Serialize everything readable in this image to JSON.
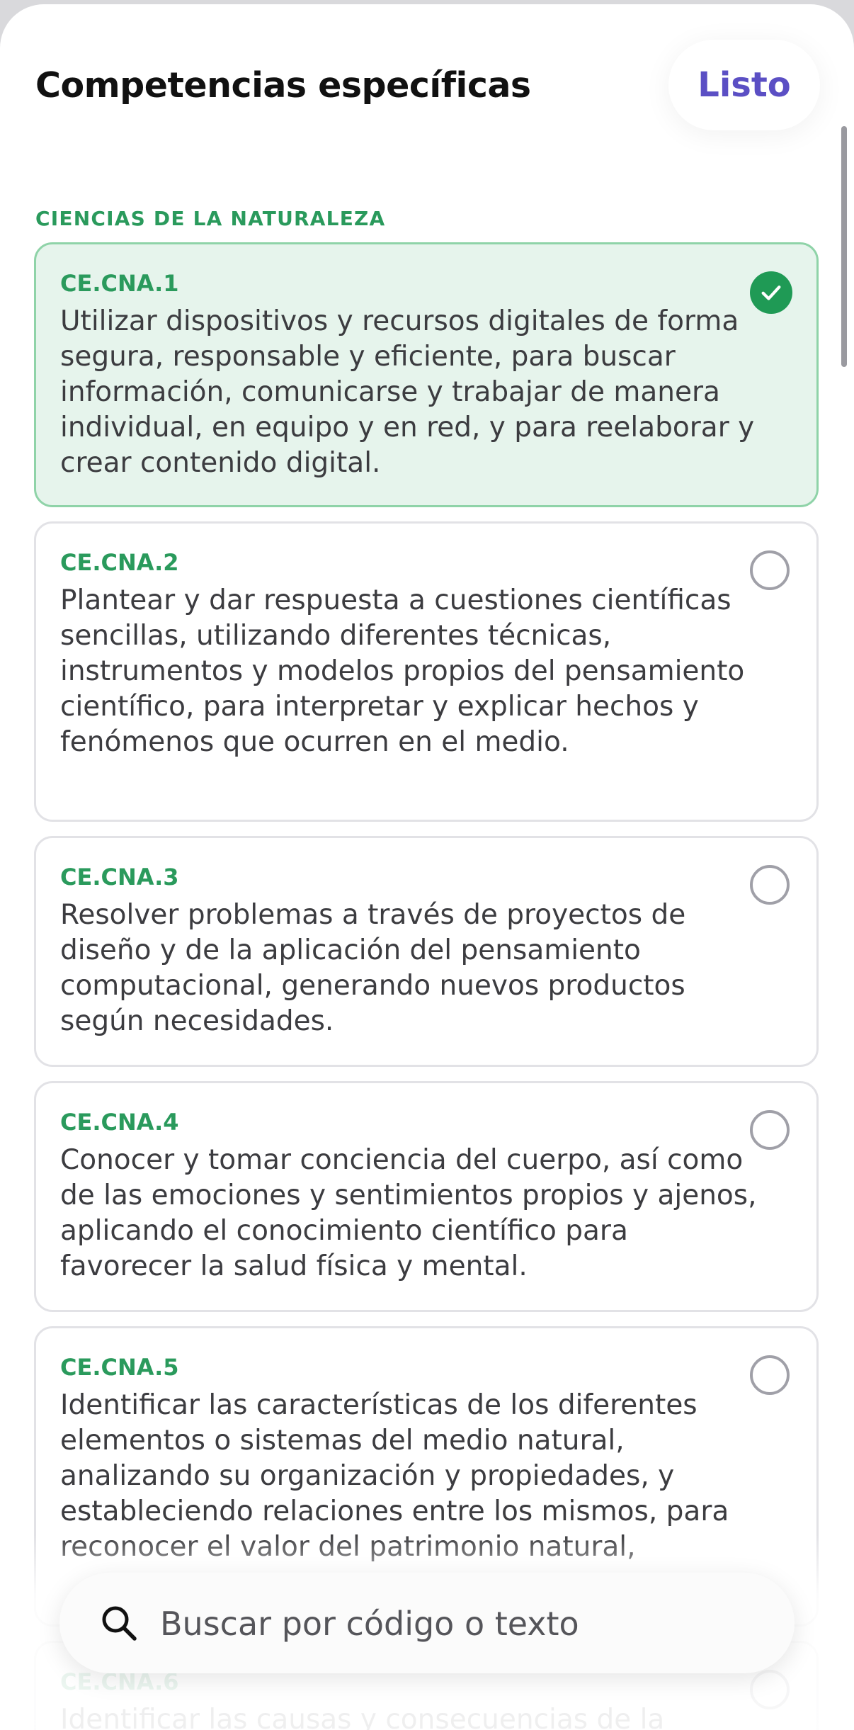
{
  "header": {
    "title": "Competencias específicas",
    "done_label": "Listo"
  },
  "section": {
    "label": "CIENCIAS DE LA NATURALEZA"
  },
  "items": [
    {
      "code": "CE.CNA.1",
      "text": "Utilizar dispositivos y recursos digitales de forma segura, responsable y eficiente, para buscar información, comunicarse y trabajar de manera individual, en equipo y en red, y para reelaborar y crear contenido digital.",
      "selected": true
    },
    {
      "code": "CE.CNA.2",
      "text": "Plantear y dar respuesta a cuestiones científicas sencillas, utilizando diferentes técnicas, instrumentos y modelos propios del pensamiento científico, para interpretar y explicar hechos y fenómenos que ocurren en el medio.",
      "selected": false
    },
    {
      "code": "CE.CNA.3",
      "text": "Resolver problemas a través de proyectos de diseño y de la aplicación del pensamiento computacional, generando nuevos productos según necesidades.",
      "selected": false
    },
    {
      "code": "CE.CNA.4",
      "text": "Conocer y tomar conciencia del cuerpo, así como de las emociones y sentimientos propios y ajenos, aplicando el conocimiento científico para favorecer la salud física y mental.",
      "selected": false
    },
    {
      "code": "CE.CNA.5",
      "text": "Identificar las características de los diferentes elementos o sistemas del medio natural, analizando su organización y propiedades, y estableciendo relaciones entre los mismos, para reconocer el valor del patrimonio natural,",
      "selected": false
    },
    {
      "code": "CE.CNA.6",
      "text": "Identificar las causas y consecuencias de la",
      "selected": false
    }
  ],
  "search": {
    "placeholder": "Buscar por código o texto"
  },
  "colors": {
    "accent_green": "#2a9a5c",
    "check_green": "#1f9a55",
    "selected_bg": "#e6f4ec",
    "button_purple": "#5b4fc4"
  }
}
